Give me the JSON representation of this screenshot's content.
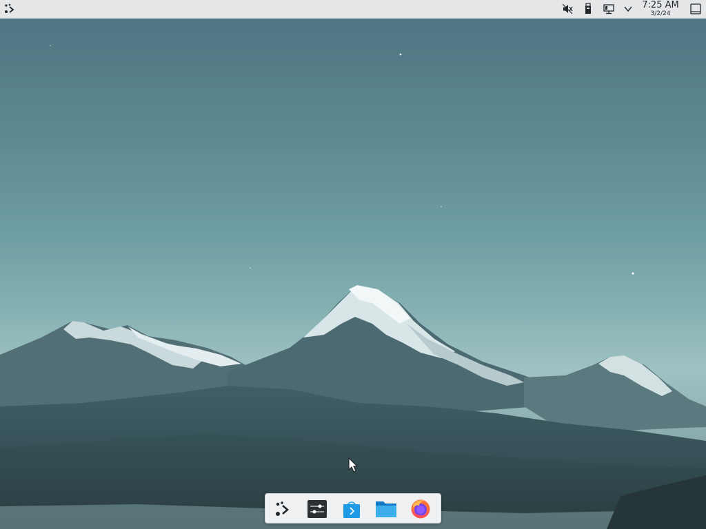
{
  "top_panel": {
    "tray_icons": [
      "audio-muted-icon",
      "usb-drive-icon",
      "network-wired-icon",
      "chevron-down-icon"
    ],
    "clock": {
      "time": "7:25 AM",
      "date": "3/2/24"
    }
  },
  "dock": {
    "items": [
      "application-launcher-icon",
      "system-settings-icon",
      "discover-store-icon",
      "file-manager-icon",
      "firefox-icon"
    ]
  },
  "colors": {
    "panel_bg": "#e4e6e8",
    "dock_bg": "#eff0f1",
    "sky_top": "#4d7380",
    "sky_bottom": "#9fc2c2",
    "folder_blue": "#1e9be4",
    "firefox_orange": "#ff7139"
  }
}
